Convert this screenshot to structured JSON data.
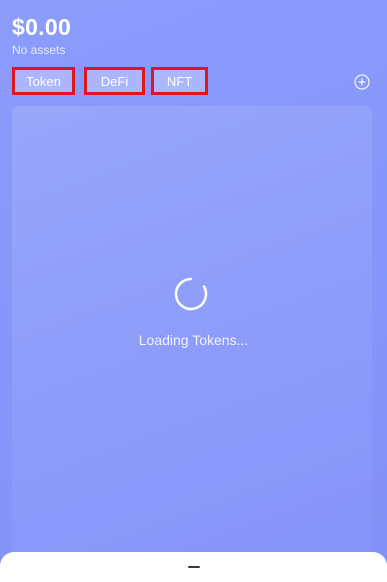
{
  "header": {
    "balance": "$0.00",
    "subtitle": "No assets"
  },
  "tabs": [
    {
      "label": "Token"
    },
    {
      "label": "DeFi"
    },
    {
      "label": "NFT"
    }
  ],
  "actions": {
    "add_icon": "plus-circle-icon"
  },
  "content": {
    "loading_text": "Loading Tokens...",
    "spinner_icon": "spinner-icon"
  },
  "colors": {
    "background": "#8797fa",
    "tab_highlight_border": "#e0161f",
    "text": "#ffffff"
  }
}
